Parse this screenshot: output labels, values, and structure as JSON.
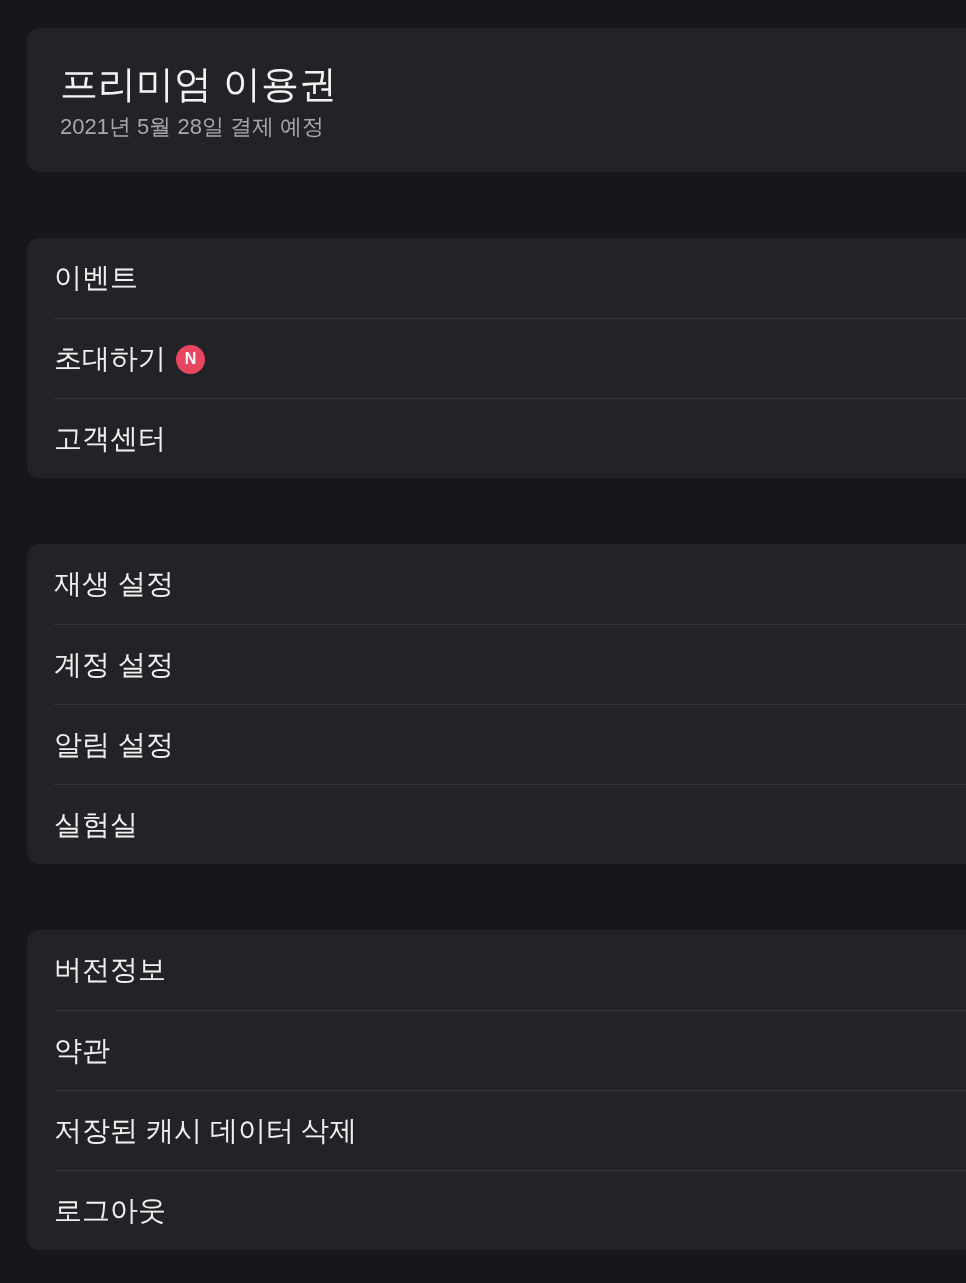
{
  "plan": {
    "title": "프리미엄 이용권",
    "subtitle": "2021년 5월 28일 결제 예정"
  },
  "groups": [
    {
      "items": [
        {
          "label": "이벤트"
        },
        {
          "label": "초대하기",
          "badge": "N"
        },
        {
          "label": "고객센터"
        }
      ]
    },
    {
      "items": [
        {
          "label": "재생 설정"
        },
        {
          "label": "계정 설정"
        },
        {
          "label": "알림 설정"
        },
        {
          "label": "실험실"
        }
      ]
    },
    {
      "items": [
        {
          "label": "버전정보"
        },
        {
          "label": "약관"
        },
        {
          "label": "저장된 캐시 데이터 삭제"
        },
        {
          "label": "로그아웃"
        }
      ]
    }
  ]
}
